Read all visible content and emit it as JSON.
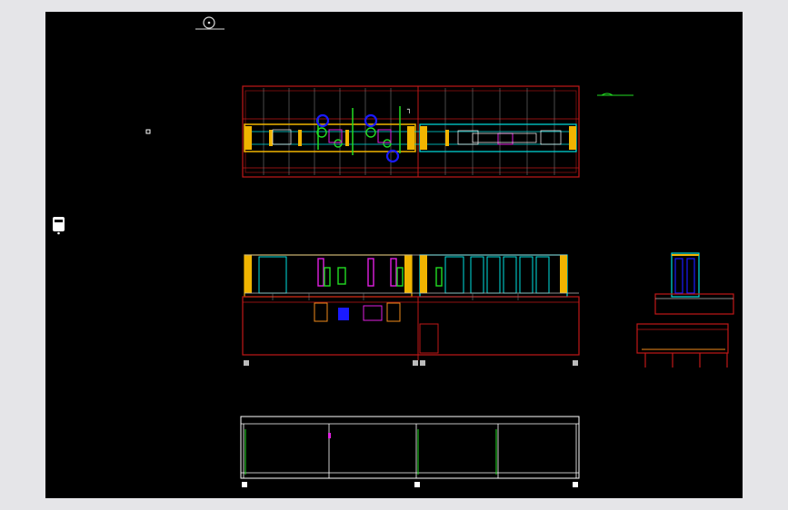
{
  "app": {
    "window": "cad-model-viewport",
    "background": "#000000",
    "chrome_background": "#e5e5e8"
  },
  "colors": {
    "frame": "#c01818",
    "frame_dark": "#8a0f0f",
    "yellow": "#f0b400",
    "orange": "#f08a1a",
    "cyan": "#00e0e0",
    "green": "#22dd22",
    "blue": "#1a1aff",
    "magenta": "#e020e0",
    "white": "#ffffff",
    "grey": "#bbbbbb"
  },
  "hud": {
    "view_cube_icon": "view-cube-icon",
    "coordinate_triad_icon": "triad-icon",
    "printer_icon": "printer-icon"
  },
  "views": [
    "top-view",
    "front-view",
    "side-view",
    "base-frame-view"
  ]
}
